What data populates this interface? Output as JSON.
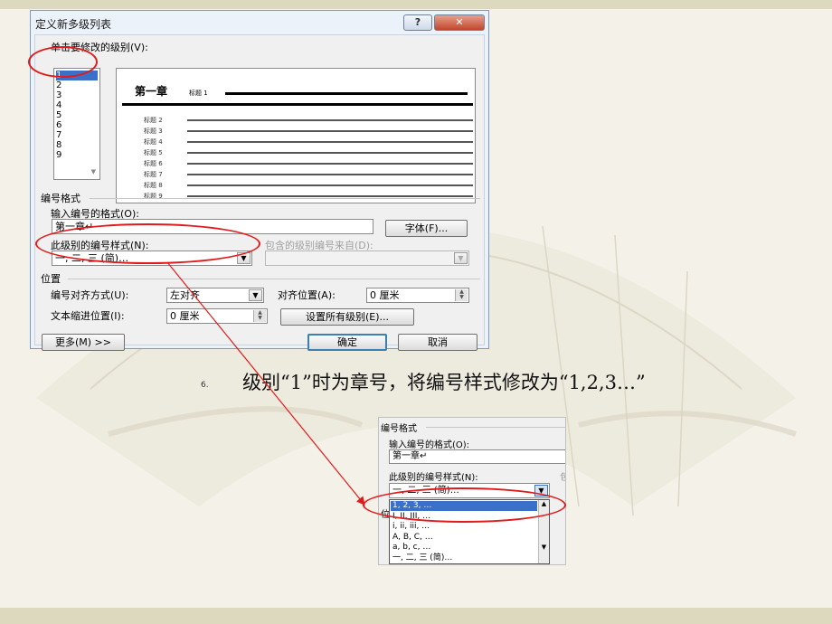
{
  "dialog": {
    "title": "定义新多级列表",
    "help_label": "?",
    "close_label": "✕",
    "level_section_label": "单击要修改的级别(V):",
    "levels": [
      "1",
      "2",
      "3",
      "4",
      "5",
      "6",
      "7",
      "8",
      "9"
    ],
    "selected_level": "1",
    "preview": {
      "chapter_text": "第一章",
      "heading1_text": "标题 1",
      "sub_headings": [
        "标题 2",
        "标题 3",
        "标题 4",
        "标题 5",
        "标题 6",
        "标题 7",
        "标题 8",
        "标题 9"
      ]
    },
    "numbering_section_label": "编号格式",
    "number_format_label": "输入编号的格式(O):",
    "number_format_value": "第一章↵",
    "font_button_label": "字体(F)...",
    "number_style_label": "此级别的编号样式(N):",
    "number_style_value": "一, 二, 三 (简)…",
    "include_level_label": "包含的级别编号来自(D):",
    "include_level_value": "",
    "position_section_label": "位置",
    "alignment_label": "编号对齐方式(U):",
    "alignment_value": "左对齐",
    "aligned_at_label": "对齐位置(A):",
    "aligned_at_value": "0 厘米",
    "indent_label": "文本缩进位置(I):",
    "indent_value": "0 厘米",
    "set_all_button_label": "设置所有级别(E)...",
    "more_button_label": "更多(M) >>",
    "ok_button_label": "确定",
    "cancel_button_label": "取消"
  },
  "caption": {
    "bullet": "6.",
    "text": "级别“1”时为章号，将编号样式修改为“1,2,3…”"
  },
  "crop": {
    "section_label": "编号格式",
    "number_format_label": "输入编号的格式(O):",
    "number_format_value": "第一章↵",
    "number_style_label": "此级别的编号样式(N):",
    "number_style_value": "一, 二, 三 (简)…",
    "cut_label_right": "包",
    "cut_label_left": "位",
    "options": [
      "1, 2, 3, …",
      "I, II, III, …",
      "i, ii, iii, …",
      "A, B, C, …",
      "a, b, c, …",
      "一, 二, 三 (简)…"
    ],
    "selected_option": "1, 2, 3, …"
  },
  "colors": {
    "highlight_ellipse": "#e11b1b",
    "selection": "#3a70c8",
    "dialog_frame": "#7d9bc0"
  }
}
